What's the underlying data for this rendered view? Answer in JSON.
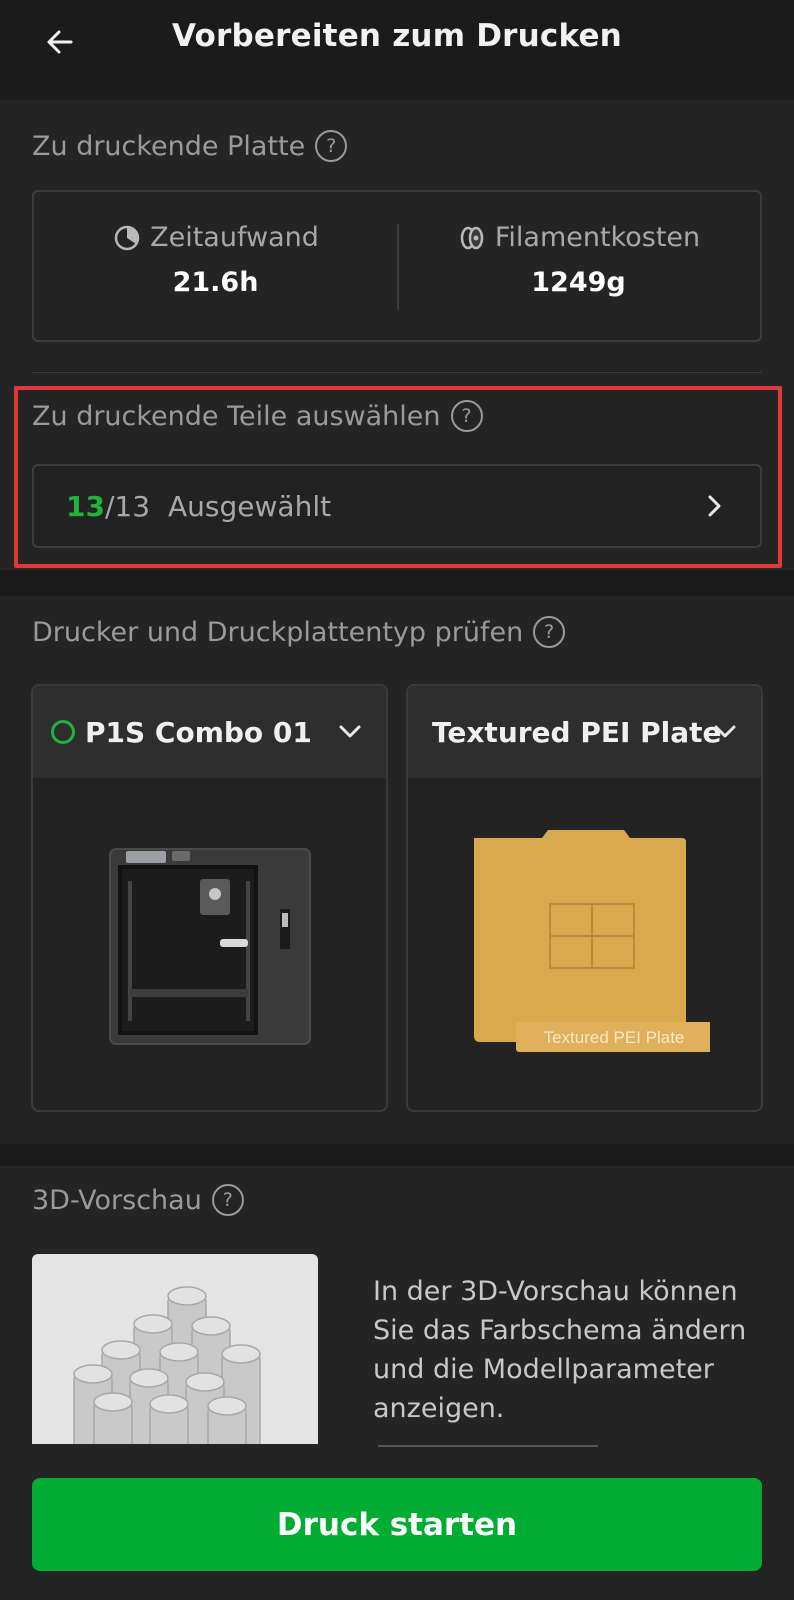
{
  "header": {
    "title": "Vorbereiten zum Drucken",
    "back_icon": "arrow-left-icon"
  },
  "plate_section": {
    "title": "Zu druckende Platte",
    "time": {
      "label": "Zeitaufwand",
      "value": "21.6h",
      "icon": "clock-icon"
    },
    "filament": {
      "label": "Filamentkosten",
      "value": "1249g",
      "icon": "filament-spool-icon"
    }
  },
  "parts_section": {
    "title": "Zu druckende Teile auswählen",
    "selected": "13",
    "total": "/13",
    "label": "Ausgewählt"
  },
  "printer_section": {
    "title": "Drucker und Druckplattentyp prüfen",
    "printer": {
      "name": "P1S Combo 01",
      "status_color": "#1fb53a"
    },
    "plate": {
      "name": "Textured PEI Plate",
      "image_label": "Textured PEI Plate"
    }
  },
  "preview_section": {
    "title": "3D-Vorschau",
    "description": "In der 3D-Vorschau können Sie das Farbschema ändern und die Modellparameter anzeigen."
  },
  "start_button": {
    "label": "Druck starten",
    "color": "#00ad32"
  },
  "highlight_color": "#e0393c"
}
